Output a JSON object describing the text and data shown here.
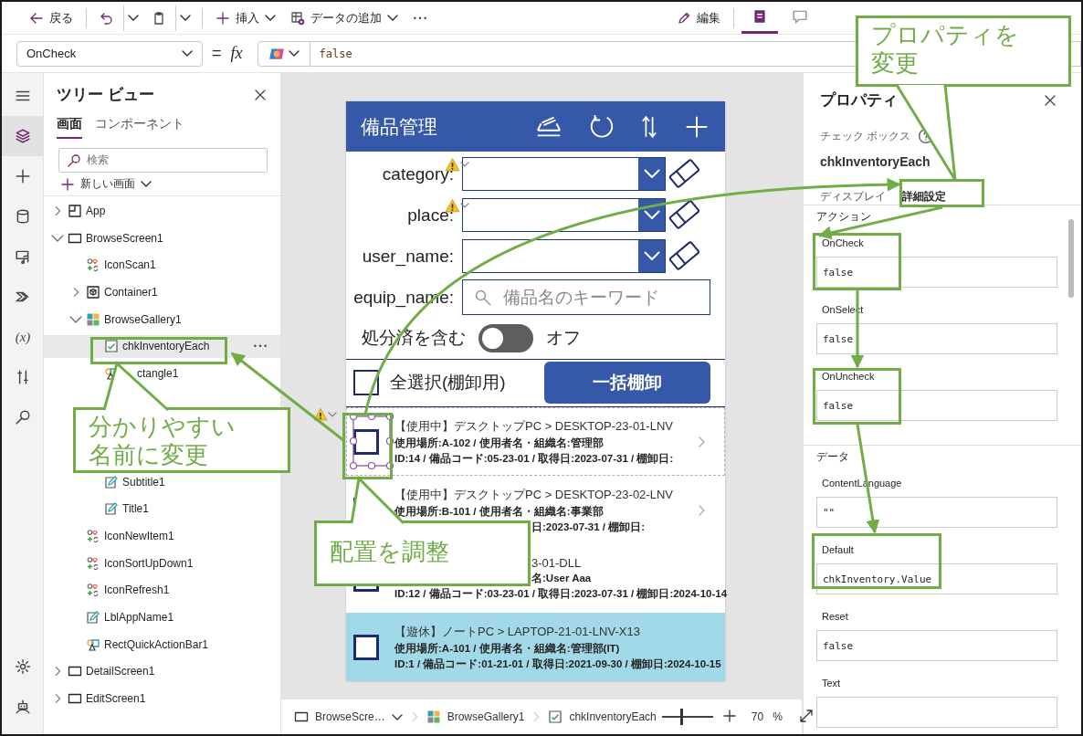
{
  "toolbar": {
    "items": [
      {
        "kind": "back",
        "label": "戻る"
      },
      {
        "kind": "undo",
        "split_caret": true
      },
      {
        "kind": "paste",
        "split_caret": true
      },
      {
        "kind": "insert",
        "label": "挿入",
        "caret": true
      },
      {
        "kind": "data",
        "label": "データの追加",
        "caret": true
      },
      {
        "kind": "more"
      }
    ],
    "edit": {
      "label": "編集"
    },
    "views": [
      {
        "kind": "notes",
        "selected": true
      },
      {
        "kind": "comments",
        "selected": false
      }
    ]
  },
  "formula_bar": {
    "property": "OnCheck",
    "equals": "=",
    "fx": "fx",
    "formula": "false"
  },
  "rail": {
    "top": [
      {
        "kind": "menu",
        "selected": false
      },
      {
        "kind": "tree",
        "selected": true
      },
      {
        "kind": "insert",
        "selected": false
      },
      {
        "kind": "data",
        "selected": false
      },
      {
        "kind": "media",
        "selected": false
      },
      {
        "kind": "automate",
        "selected": false
      },
      {
        "kind": "variables",
        "label": "(x)",
        "selected": false
      },
      {
        "kind": "tools",
        "selected": false
      },
      {
        "kind": "search",
        "selected": false
      }
    ],
    "bottom": [
      {
        "kind": "settings",
        "selected": false
      },
      {
        "kind": "copilot",
        "selected": false
      }
    ]
  },
  "tree_view": {
    "title": "ツリー ビュー",
    "tabs": [
      {
        "label": "画面",
        "selected": true
      },
      {
        "label": "コンポーネント",
        "selected": false
      }
    ],
    "search_placeholder": "検索",
    "new_screen": "新しい画面",
    "items": [
      {
        "label": "App",
        "kind": "app",
        "expanded": false,
        "selected": false
      },
      {
        "label": "BrowseScreen1",
        "kind": "screen",
        "expanded": true,
        "selected": false,
        "children": [
          {
            "label": "IconScan1",
            "kind": "icon",
            "selected": false
          },
          {
            "label": "Container1",
            "kind": "container",
            "expanded": false,
            "selected": false
          },
          {
            "label": "BrowseGallery1",
            "kind": "gallery",
            "expanded": true,
            "selected": false,
            "children": [
              {
                "label": "chkInventoryEach",
                "kind": "checkbox",
                "selected": true
              },
              {
                "label": "ctangle1",
                "kind": "rectangle",
                "selected": false,
                "covered": true
              },
              {
                "label": "Subtitle1",
                "kind": "label",
                "selected": false
              },
              {
                "label": "Title1",
                "kind": "label",
                "selected": false
              }
            ]
          },
          {
            "label": "IconNewItem1",
            "kind": "icon",
            "selected": false
          },
          {
            "label": "IconSortUpDown1",
            "kind": "icon",
            "selected": false
          },
          {
            "label": "IconRefresh1",
            "kind": "icon",
            "selected": false
          },
          {
            "label": "LblAppName1",
            "kind": "label",
            "selected": false
          },
          {
            "label": "RectQuickActionBar1",
            "kind": "rectangle",
            "selected": false
          }
        ]
      },
      {
        "label": "DetailScreen1",
        "kind": "screen",
        "expanded": false,
        "selected": false
      },
      {
        "label": "EditScreen1",
        "kind": "screen",
        "expanded": false,
        "selected": false
      }
    ]
  },
  "app_preview": {
    "title": "備品管理",
    "header_icons": [
      {
        "kind": "scan"
      },
      {
        "kind": "refresh"
      },
      {
        "kind": "sort"
      },
      {
        "kind": "add"
      }
    ],
    "filters": [
      {
        "label": "category:",
        "kind": "dropdown",
        "warning": true
      },
      {
        "label": "place:",
        "kind": "dropdown",
        "warning": true
      },
      {
        "label": "user_name:",
        "kind": "dropdown",
        "warning": false
      },
      {
        "label": "equip_name:",
        "kind": "search",
        "placeholder": "備品名のキーワード"
      }
    ],
    "toggle": {
      "label": "処分済を含む",
      "on": false,
      "state_text": "オフ"
    },
    "select_all": {
      "label": "全選択(棚卸用)",
      "checked": false
    },
    "bulk_button": "一括棚卸",
    "gallery": [
      {
        "checked": false,
        "selected": false,
        "focused": true,
        "warning": true,
        "lines": [
          {
            "text": "【使用中】デスクトップPC > DESKTOP-23-01-LNV",
            "covered": false
          },
          {
            "text": "使用場所:A-102 / 使用者名・組織名:管理部",
            "covered": false
          },
          {
            "text": "ID:14 / 備品コード:05-23-01 / 取得日:2023-07-31 / 棚卸日:",
            "covered": false
          }
        ]
      },
      {
        "selected": false,
        "focused": false,
        "warning": false,
        "lines": [
          {
            "text": "【使用中】デスクトップPC > DESKTOP-23-02-LNV",
            "covered": false
          },
          {
            "text": "使用場所:B-101 / 使用者名・組織名:事業部",
            "covered": false
          },
          {
            "text": "日:2023-07-31 / 棚卸日:",
            "covered": true
          }
        ]
      },
      {
        "checked": false,
        "selected": false,
        "focused": false,
        "warning": false,
        "lines": [
          {
            "text": "3-01-DLL",
            "covered": true
          },
          {
            "text": "名:User Aaa",
            "covered": true
          },
          {
            "text": "ID:12 / 備品コード:03-23-01 / 取得日:2023-07-31 / 棚卸日:2024-10-14",
            "covered": false
          }
        ]
      },
      {
        "checked": false,
        "selected": true,
        "focused": false,
        "warning": false,
        "lines": [
          {
            "text": "【遊休】ノートPC > LAPTOP-21-01-LNV-X13",
            "covered": false
          },
          {
            "text": "使用場所:A-101 / 使用者名・組織名:管理部(IT)",
            "covered": false
          },
          {
            "text": "ID:1 / 備品コード:01-21-01 / 取得日:2021-09-30 / 棚卸日:2024-10-15",
            "covered": false
          }
        ]
      }
    ]
  },
  "status_bar": {
    "breadcrumbs": [
      {
        "kind": "screen",
        "label": "BrowseScre…",
        "caret": true
      },
      {
        "kind": "gallery",
        "label": "BrowseGallery1",
        "caret": false
      },
      {
        "kind": "checkbox",
        "label": "chkInventoryEach",
        "caret": false
      }
    ],
    "zoom": {
      "level": 0.38,
      "value": "70",
      "unit": "%"
    }
  },
  "properties": {
    "title": "プロパティ",
    "control_type": "チェック ボックス",
    "control_name": "chkInventoryEach",
    "tabs": [
      {
        "label": "ディスプレイ",
        "selected": false
      },
      {
        "label": "詳細設定",
        "selected": true
      }
    ],
    "sections": [
      {
        "title": "アクション",
        "fields": [
          {
            "label": "OnCheck",
            "value": "false"
          },
          {
            "label": "OnSelect",
            "value": "false"
          },
          {
            "label": "OnUncheck",
            "value": "false"
          }
        ]
      },
      {
        "title": "データ",
        "fields": [
          {
            "label": "ContentLanguage",
            "value": "\"\""
          },
          {
            "label": "Default",
            "value": "chkInventory.Value"
          },
          {
            "label": "Reset",
            "value": "false"
          },
          {
            "label": "Text"
          }
        ]
      }
    ]
  },
  "annotations": [
    {
      "kind": "properties",
      "lines": [
        "プロパティを",
        "変更"
      ]
    },
    {
      "kind": "rename",
      "lines": [
        "分かりやすい",
        "名前に変更"
      ]
    },
    {
      "kind": "placement",
      "lines": [
        "配置を調整"
      ]
    }
  ]
}
